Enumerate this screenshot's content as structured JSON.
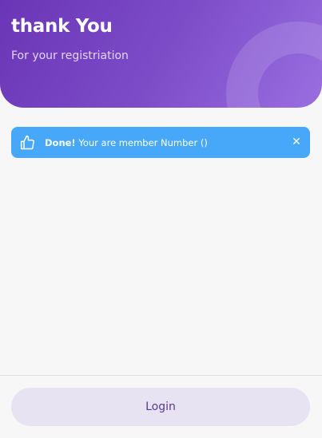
{
  "header": {
    "title": "thank You",
    "subtitle": "For your registriation"
  },
  "alert": {
    "icon": "thumbs-up-icon",
    "strong": "Done!",
    "message": " Your are member Number ()",
    "close_icon": "close-icon",
    "close_glyph": "✕",
    "color": "#47a8f9"
  },
  "footer": {
    "login_label": "Login"
  },
  "colors": {
    "header_start": "#6a35b6",
    "header_end": "#9a6ee0",
    "button_bg": "#e8e3f2",
    "button_text": "#5a3a8f"
  }
}
